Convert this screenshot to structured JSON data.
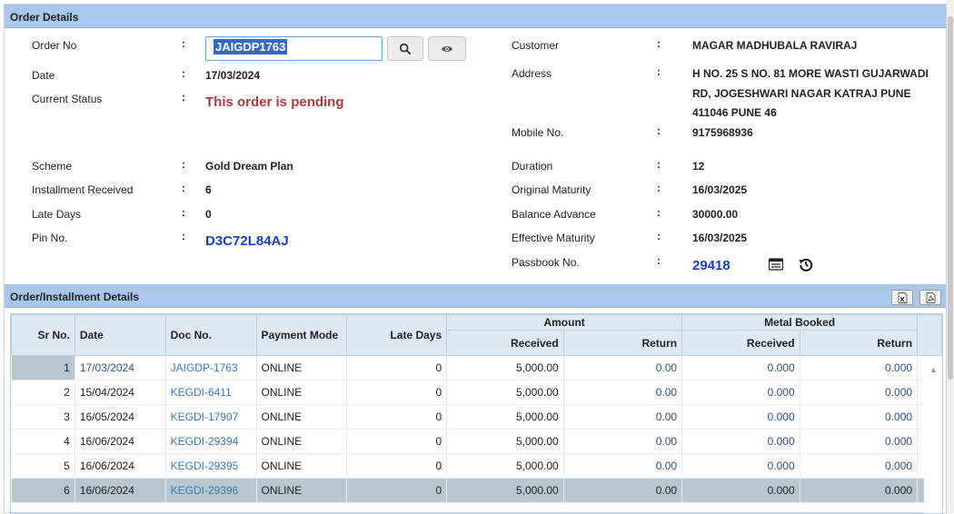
{
  "panel1_title": "Order Details",
  "panel2_title": "Order/Installment Details",
  "colon": ":",
  "left": {
    "order_no_label": "Order No",
    "order_no_value": "JAIGDP1763",
    "date_label": "Date",
    "date_value": "17/03/2024",
    "status_label": "Current Status",
    "status_value": "This order is pending",
    "scheme_label": "Scheme",
    "scheme_value": "Gold Dream Plan",
    "inst_label": "Installment Received",
    "inst_value": "6",
    "late_label": "Late Days",
    "late_value": "0",
    "pin_label": "Pin No.",
    "pin_value": "D3C72L84AJ"
  },
  "right": {
    "customer_label": "Customer",
    "customer_value": "MAGAR MADHUBALA RAVIRAJ",
    "address_label": "Address",
    "address_line1": "H NO. 25 S NO. 81 MORE WASTI GUJARWADI",
    "address_line2": "RD, JOGESHWARI NAGAR KATRAJ PUNE",
    "address_line3": "411046 PUNE 46",
    "mobile_label": "Mobile No.",
    "mobile_value": "9175968936",
    "duration_label": "Duration",
    "duration_value": "12",
    "orig_label": "Original Maturity",
    "orig_value": "16/03/2025",
    "bal_label": "Balance Advance",
    "bal_value": "30000.00",
    "eff_label": "Effective Maturity",
    "eff_value": "16/03/2025",
    "passbook_label": "Passbook No.",
    "passbook_value": "29418"
  },
  "grid": {
    "headers": {
      "sr": "Sr No.",
      "date": "Date",
      "doc": "Doc No.",
      "mode": "Payment Mode",
      "late": "Late Days",
      "amount": "Amount",
      "metal": "Metal Booked",
      "received": "Received",
      "return": "Return"
    },
    "rows": [
      {
        "sr": "1",
        "date": "17/03/2024",
        "doc": "JAIGDP-1763",
        "mode": "ONLINE",
        "late": "0",
        "amt_recv": "5,000.00",
        "amt_ret": "0.00",
        "met_recv": "0.000",
        "met_ret": "0.000"
      },
      {
        "sr": "2",
        "date": "15/04/2024",
        "doc": "KEGDI-6411",
        "mode": "ONLINE",
        "late": "0",
        "amt_recv": "5,000.00",
        "amt_ret": "0.00",
        "met_recv": "0.000",
        "met_ret": "0.000"
      },
      {
        "sr": "3",
        "date": "16/05/2024",
        "doc": "KEGDI-17907",
        "mode": "ONLINE",
        "late": "0",
        "amt_recv": "5,000.00",
        "amt_ret": "0.00",
        "met_recv": "0.000",
        "met_ret": "0.000"
      },
      {
        "sr": "4",
        "date": "16/06/2024",
        "doc": "KEGDI-29394",
        "mode": "ONLINE",
        "late": "0",
        "amt_recv": "5,000.00",
        "amt_ret": "0.00",
        "met_recv": "0.000",
        "met_ret": "0.000"
      },
      {
        "sr": "5",
        "date": "16/06/2024",
        "doc": "KEGDI-29395",
        "mode": "ONLINE",
        "late": "0",
        "amt_recv": "5,000.00",
        "amt_ret": "0.00",
        "met_recv": "0.000",
        "met_ret": "0.000"
      },
      {
        "sr": "6",
        "date": "16/06/2024",
        "doc": "KEGDI-29396",
        "mode": "ONLINE",
        "late": "0",
        "amt_recv": "5,000.00",
        "amt_ret": "0.00",
        "met_recv": "0.000",
        "met_ret": "0.000"
      }
    ]
  },
  "icons": {
    "search": "search-icon",
    "view": "eye-icon",
    "passbook": "card-icon",
    "history": "history-icon",
    "excel": "excel-icon",
    "pdf": "pdf-icon"
  },
  "colors": {
    "header_bg": "#a8c7ea",
    "status_red": "#b03a3a",
    "pin_blue": "#1a3cc8",
    "selected_row": "#b6c7d0"
  }
}
